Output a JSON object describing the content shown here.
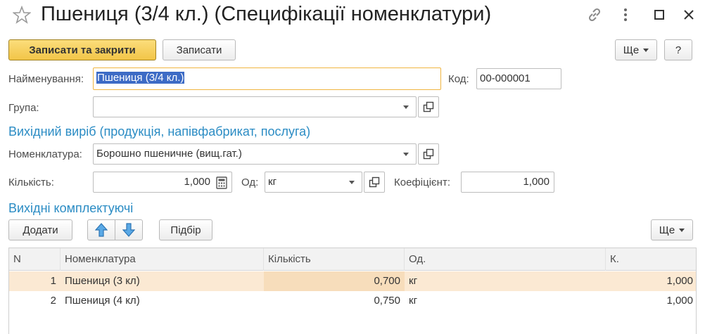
{
  "header": {
    "title": "Пшениця (3/4 кл.) (Специфікації номенклатури)",
    "icons": [
      "star-icon",
      "link-icon",
      "more-vertical-icon",
      "maximize-icon",
      "close-icon"
    ]
  },
  "toolbar": {
    "save_close_label": "Записати та закрити",
    "save_label": "Записати",
    "more_label": "Ще",
    "help_label": "?"
  },
  "form": {
    "name_label": "Найменування:",
    "name_value": "Пшениця (3/4 кл.)",
    "code_label": "Код:",
    "code_value": "00-000001",
    "group_label": "Група:",
    "group_value": ""
  },
  "output_section": {
    "title": "Вихідний виріб (продукція, напівфабрикат, послуга)",
    "nomenclature_label": "Номенклатура:",
    "nomenclature_value": "Борошно пшеничне (вищ.гат.)",
    "quantity_label": "Кількість:",
    "quantity_value": "1,000",
    "unit_label": "Од:",
    "unit_value": "кг",
    "coef_label": "Коефіцієнт:",
    "coef_value": "1,000"
  },
  "components_section": {
    "title": "Вихідні комплектуючі",
    "add_label": "Додати",
    "pick_label": "Підбір",
    "more_label": "Ще"
  },
  "table": {
    "columns": [
      "N",
      "Номенклатура",
      "Кількість",
      "Од.",
      "К."
    ],
    "rows": [
      {
        "n": "1",
        "name": "Пшениця (3 кл)",
        "qty": "0,700",
        "unit": "кг",
        "k": "1,000"
      },
      {
        "n": "2",
        "name": "Пшениця (4 кл)",
        "qty": "0,750",
        "unit": "кг",
        "k": "1,000"
      }
    ]
  },
  "colors": {
    "accent": "#2b8cc4",
    "primary_button": "#f2c548",
    "selected_row": "#fbe9d3",
    "focus_border": "#f0b540"
  }
}
